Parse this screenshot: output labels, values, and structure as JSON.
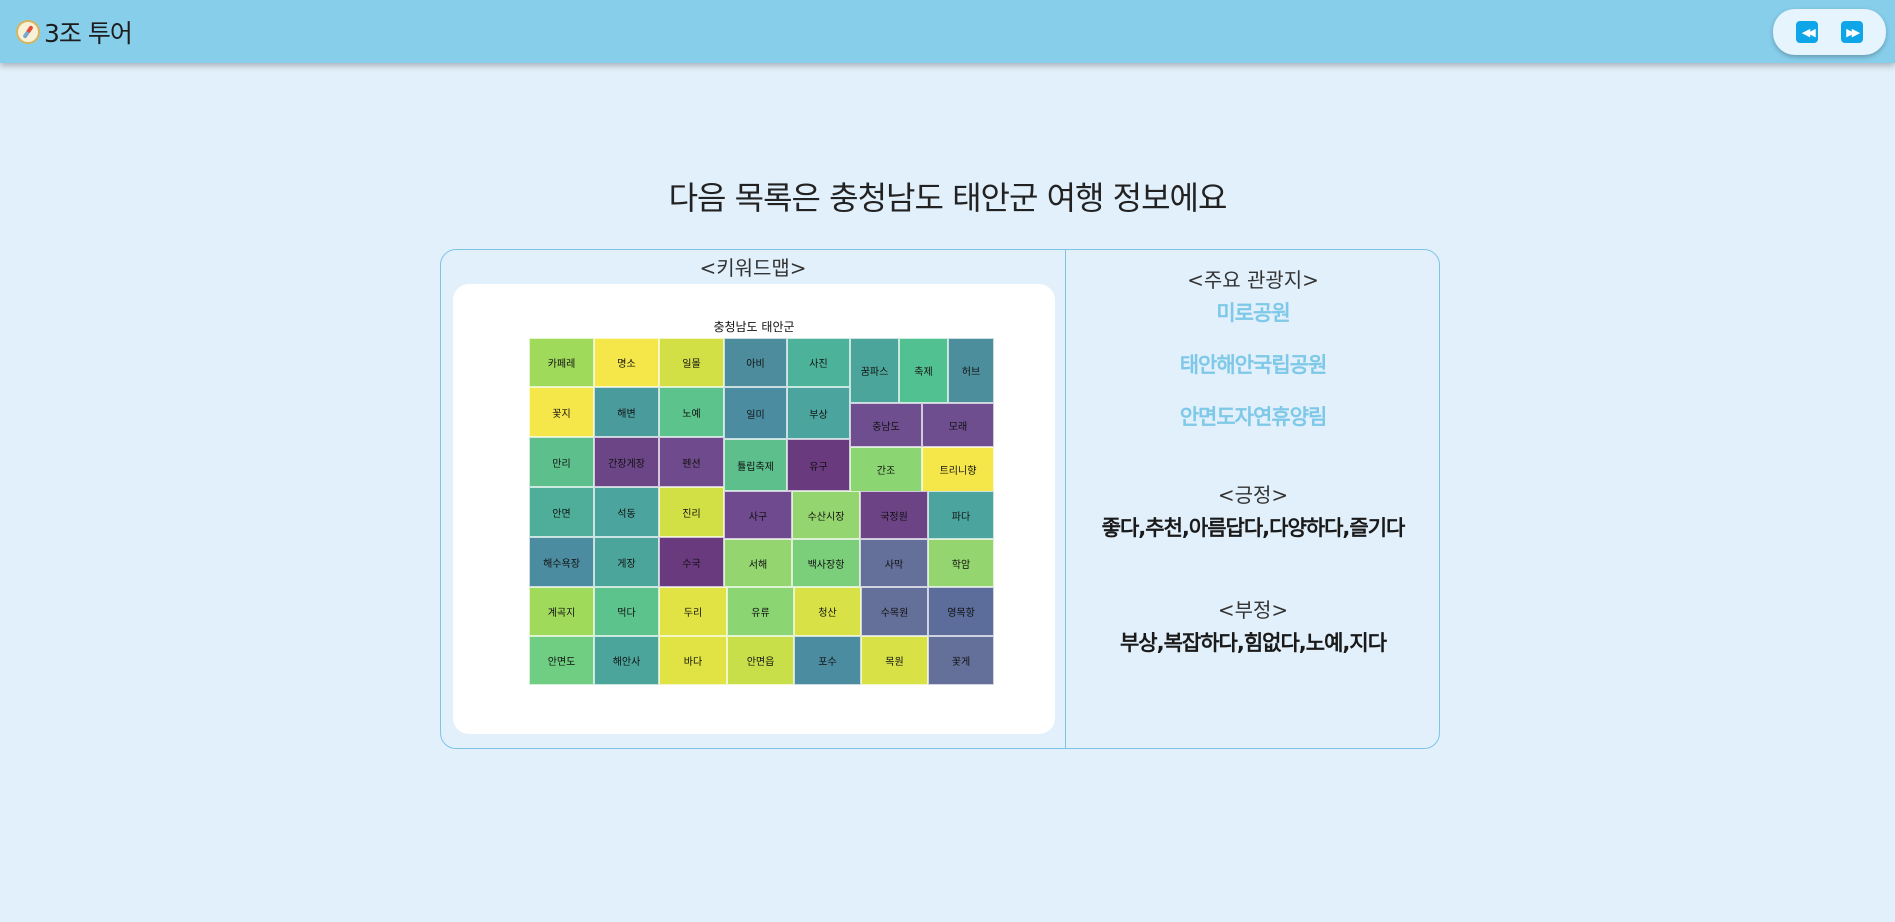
{
  "app": {
    "title": "3조 투어",
    "logo_icon": "compass-icon"
  },
  "nav": {
    "prev_icon": "rewind-icon",
    "next_icon": "fast-forward-icon",
    "prev_glyph": "◀◀",
    "next_glyph": "▶▶"
  },
  "headline": "다음 목록은 충청남도 태안군 여행 정보에요",
  "keyword_map": {
    "label": "<키워드맵>",
    "title": "충청남도 태안군",
    "tiles": [
      {
        "text": "카페레",
        "color": "#a0da5a"
      },
      {
        "text": "명소",
        "color": "#f5e649"
      },
      {
        "text": "일몰",
        "color": "#d3e045"
      },
      {
        "text": "아비",
        "color": "#4c8c9c"
      },
      {
        "text": "사진",
        "color": "#4cb39a"
      },
      {
        "text": "꿈파스",
        "color": "#4ca59b"
      },
      {
        "text": "축제",
        "color": "#52c191"
      },
      {
        "text": "허브",
        "color": "#4d8e9c"
      },
      {
        "text": "꽃지",
        "color": "#f5e649"
      },
      {
        "text": "해변",
        "color": "#4a9b9c"
      },
      {
        "text": "노예",
        "color": "#5cc38c"
      },
      {
        "text": "일미",
        "color": "#4c8ca0"
      },
      {
        "text": "부상",
        "color": "#4ca49e"
      },
      {
        "text": "충남도",
        "color": "#6f4e8f"
      },
      {
        "text": "모래",
        "color": "#6e4e8f"
      },
      {
        "text": "만리",
        "color": "#5cbf8c"
      },
      {
        "text": "간장게장",
        "color": "#6c4586"
      },
      {
        "text": "펜션",
        "color": "#6f4a8c"
      },
      {
        "text": "튤립축제",
        "color": "#5cbf8c"
      },
      {
        "text": "유구",
        "color": "#6a3a7e"
      },
      {
        "text": "간조",
        "color": "#8bd673"
      },
      {
        "text": "트리니향",
        "color": "#f5e649"
      },
      {
        "text": "안면",
        "color": "#4fae9a"
      },
      {
        "text": "석동",
        "color": "#4ca49e"
      },
      {
        "text": "진리",
        "color": "#d3e045"
      },
      {
        "text": "사구",
        "color": "#6f4a8e"
      },
      {
        "text": "수산시장",
        "color": "#94d570"
      },
      {
        "text": "국정원",
        "color": "#6c4486"
      },
      {
        "text": "파다",
        "color": "#4ca49e"
      },
      {
        "text": "해수욕장",
        "color": "#4c8ca0"
      },
      {
        "text": "게장",
        "color": "#4ca59b"
      },
      {
        "text": "수국",
        "color": "#6a3a7e"
      },
      {
        "text": "서해",
        "color": "#94d570"
      },
      {
        "text": "백사장항",
        "color": "#7ccf7a"
      },
      {
        "text": "사막",
        "color": "#64709a"
      },
      {
        "text": "학암",
        "color": "#94d570"
      },
      {
        "text": "계곡지",
        "color": "#a0da5a"
      },
      {
        "text": "먹다",
        "color": "#5cc38c"
      },
      {
        "text": "두리",
        "color": "#e0e343"
      },
      {
        "text": "유류",
        "color": "#8bd673"
      },
      {
        "text": "청산",
        "color": "#d8e247"
      },
      {
        "text": "수목원",
        "color": "#64709a"
      },
      {
        "text": "영목항",
        "color": "#5c6d9c"
      },
      {
        "text": "안면도",
        "color": "#6fce82"
      },
      {
        "text": "해안사",
        "color": "#4ca59b"
      },
      {
        "text": "바다",
        "color": "#e0e343"
      },
      {
        "text": "안면읍",
        "color": "#c8df4a"
      },
      {
        "text": "포수",
        "color": "#4c8ca0"
      },
      {
        "text": "목원",
        "color": "#d8e247"
      },
      {
        "text": "꽃게",
        "color": "#64709a"
      }
    ]
  },
  "attractions": {
    "label": "<주요 관광지>",
    "items": [
      "미로공원",
      "태안해안국립공원",
      "안면도자연휴양림"
    ]
  },
  "positive": {
    "label": "<긍정>",
    "words": "좋다,추천,아름답다,다양하다,즐기다"
  },
  "negative": {
    "label": "<부정>",
    "words": "부상,복잡하다,힘없다,노예,지다"
  }
}
